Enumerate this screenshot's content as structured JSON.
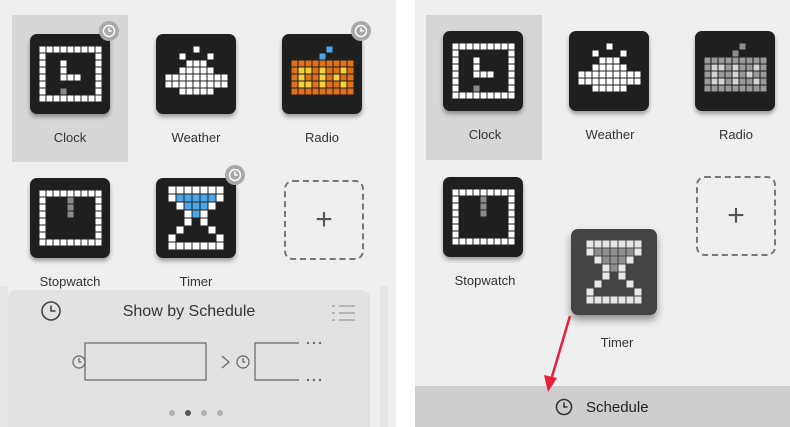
{
  "left_panel": {
    "widgets": [
      {
        "label": "Clock",
        "icon": "clock-icon"
      },
      {
        "label": "Weather",
        "icon": "cloud-icon"
      },
      {
        "label": "Radio",
        "icon": "radio-icon"
      },
      {
        "label": "Stopwatch",
        "icon": "stopwatch-icon"
      },
      {
        "label": "Timer",
        "icon": "hourglass-icon"
      }
    ],
    "add_label": "+",
    "schedule": {
      "title": "Show by Schedule",
      "page_count": 4,
      "active_page": 2
    }
  },
  "right_panel": {
    "widgets": [
      {
        "label": "Clock",
        "icon": "clock-icon"
      },
      {
        "label": "Weather",
        "icon": "cloud-icon"
      },
      {
        "label": "Radio",
        "icon": "radio-icon"
      },
      {
        "label": "Stopwatch",
        "icon": "stopwatch-icon"
      },
      {
        "label": "Timer",
        "icon": "hourglass-icon"
      }
    ],
    "add_label": "+",
    "bottom_bar": {
      "label": "Schedule",
      "icon": "clock-icon"
    }
  },
  "colors": {
    "accent_arrow": "#e8213a",
    "badge": "#a9a9a9",
    "radio_orange": "#e0701a",
    "radio_yellow": "#f4d23c",
    "timer_blue": "#4aa6e8"
  }
}
